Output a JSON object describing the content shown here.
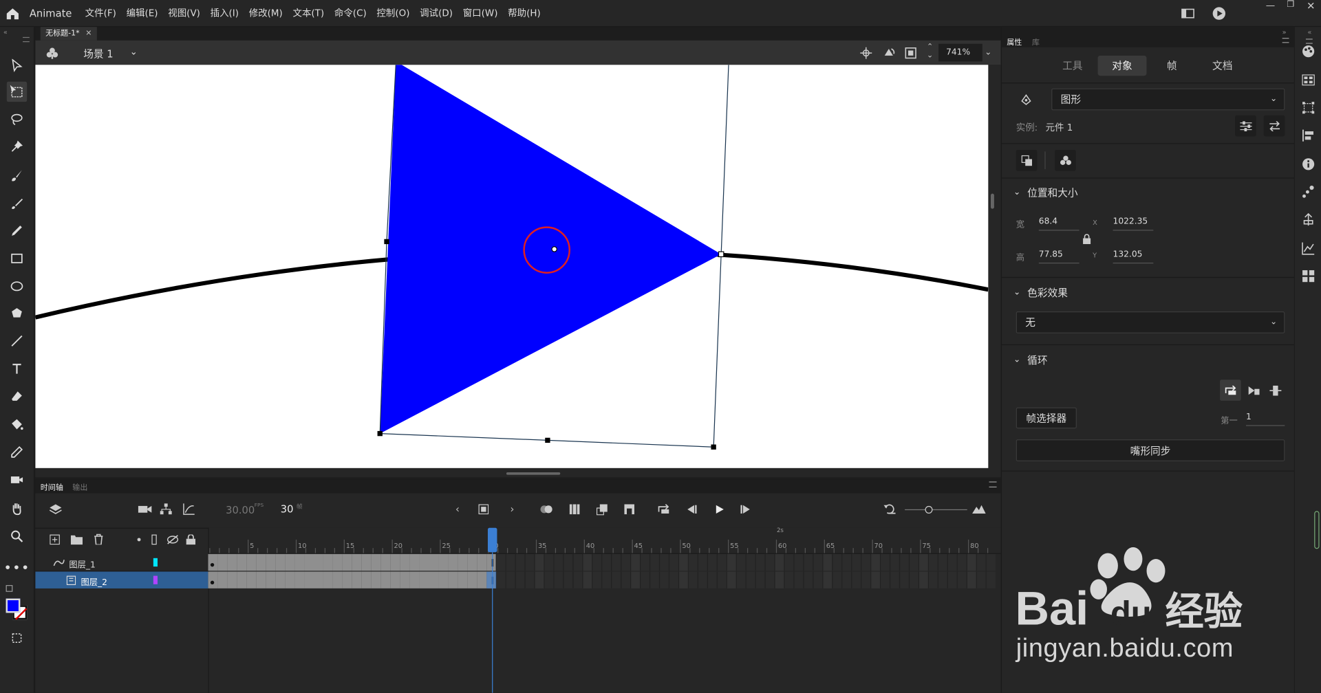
{
  "app": {
    "name": "Animate"
  },
  "menu": [
    "文件(F)",
    "编辑(E)",
    "视图(V)",
    "插入(I)",
    "修改(M)",
    "文本(T)",
    "命令(C)",
    "控制(O)",
    "调试(D)",
    "窗口(W)",
    "帮助(H)"
  ],
  "document": {
    "tab": "无标题-1*",
    "scene": "场景 1",
    "zoom": "741%"
  },
  "timeline": {
    "tabs": [
      "时间轴",
      "输出"
    ],
    "fps": "30.00",
    "fps_unit": "FPS",
    "current_frame": "30",
    "frame_unit": "帧",
    "seconds_marker": "2s",
    "frame_ticks": [
      "5",
      "10",
      "15",
      "20",
      "25",
      "30",
      "35",
      "40",
      "45",
      "50",
      "55",
      "60",
      "65",
      "70",
      "75",
      "80"
    ],
    "layers": [
      {
        "name": "图层_1",
        "color": "#00e5ff",
        "selected": false
      },
      {
        "name": "图层_2",
        "color": "#b044ff",
        "selected": true
      }
    ]
  },
  "properties": {
    "panel_tabs": [
      "属性",
      "库"
    ],
    "tabs": [
      "工具",
      "对象",
      "帧",
      "文档"
    ],
    "active_tab": "对象",
    "symbol_type": "图形",
    "instance_label": "实例:",
    "instance_name": "元件 1",
    "position_section": "位置和大小",
    "width_label": "宽",
    "width": "68.4",
    "height_label": "高",
    "height": "77.85",
    "x_label": "X",
    "x": "1022.35",
    "y_label": "Y",
    "y": "132.05",
    "color_section": "色彩效果",
    "color_effect": "无",
    "loop_section": "循环",
    "frame_picker": "帧选择器",
    "first_label": "第一",
    "first_value": "1",
    "lip_sync": "嘴形同步"
  },
  "colors": {
    "fill": "#0000ff",
    "accent": "#3b7fd4",
    "stage": "#ffffff"
  },
  "watermark": {
    "brand": "Bai du 经验",
    "url": "jingyan.baidu.com"
  }
}
